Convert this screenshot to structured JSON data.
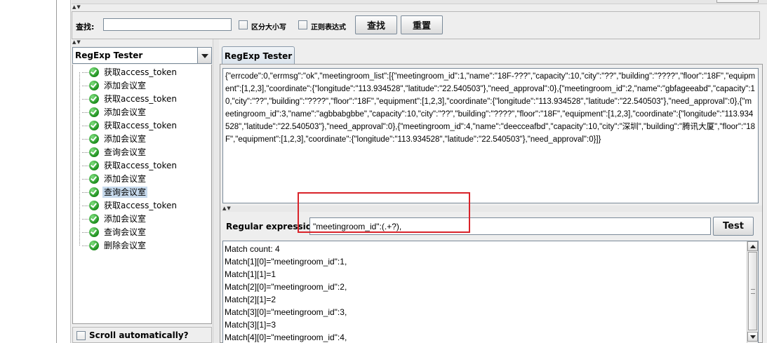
{
  "search": {
    "label": "查找:",
    "value": "",
    "case_sensitive_label": "区分大小写",
    "regex_label": "正则表达式",
    "find_button": "查找",
    "reset_button": "重置"
  },
  "tree": {
    "selector_value": "RegExp Tester",
    "items": [
      {
        "label": "获取access_token"
      },
      {
        "label": "添加会议室"
      },
      {
        "label": "获取access_token"
      },
      {
        "label": "添加会议室"
      },
      {
        "label": "获取access_token"
      },
      {
        "label": "添加会议室"
      },
      {
        "label": "查询会议室"
      },
      {
        "label": "获取access_token"
      },
      {
        "label": "添加会议室"
      },
      {
        "label": "查询会议室"
      },
      {
        "label": "获取access_token"
      },
      {
        "label": "添加会议室"
      },
      {
        "label": "查询会议室"
      },
      {
        "label": "删除会议室"
      }
    ],
    "selected_index": 9,
    "scroll_auto_label": "Scroll automatically?"
  },
  "tester": {
    "tab_label": "RegExp Tester",
    "response_text": "{\"errcode\":0,\"errmsg\":\"ok\",\"meetingroom_list\":[{\"meetingroom_id\":1,\"name\":\"18F-???\",\"capacity\":10,\"city\":\"??\",\"building\":\"????\",\"floor\":\"18F\",\"equipment\":[1,2,3],\"coordinate\":{\"longitude\":\"113.934528\",\"latitude\":\"22.540503\"},\"need_approval\":0},{\"meetingroom_id\":2,\"name\":\"gbfageeabd\",\"capacity\":10,\"city\":\"??\",\"building\":\"????\",\"floor\":\"18F\",\"equipment\":[1,2,3],\"coordinate\":{\"longitude\":\"113.934528\",\"latitude\":\"22.540503\"},\"need_approval\":0},{\"meetingroom_id\":3,\"name\":\"agbbabgbbe\",\"capacity\":10,\"city\":\"??\",\"building\":\"????\",\"floor\":\"18F\",\"equipment\":[1,2,3],\"coordinate\":{\"longitude\":\"113.934528\",\"latitude\":\"22.540503\"},\"need_approval\":0},{\"meetingroom_id\":4,\"name\":\"deecceafbd\",\"capacity\":10,\"city\":\"深圳\",\"building\":\"腾讯大厦\",\"floor\":\"18F\",\"equipment\":[1,2,3],\"coordinate\":{\"longitude\":\"113.934528\",\"latitude\":\"22.540503\"},\"need_approval\":0}]}",
    "regex_label": "Regular expression:",
    "regex_value": "\"meetingroom_id\":(.+?),",
    "test_button": "Test",
    "results": [
      "Match count: 4",
      "Match[1][0]=\"meetingroom_id\":1,",
      "Match[1][1]=1",
      "Match[2][0]=\"meetingroom_id\":2,",
      "Match[2][1]=2",
      "Match[3][0]=\"meetingroom_id\":3,",
      "Match[3][1]=3",
      "Match[4][0]=\"meetingroom_id\":4,"
    ]
  },
  "colors": {
    "highlight": "#d9232a",
    "selection": "#c8dbee",
    "tree_icon": "#1d8f1d"
  }
}
